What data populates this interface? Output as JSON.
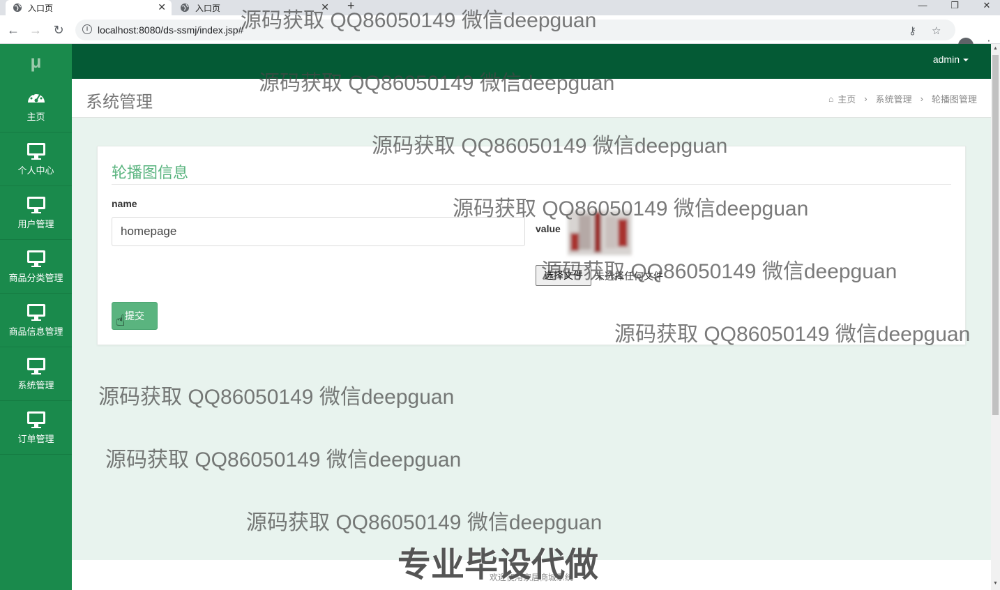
{
  "browser": {
    "tabs": [
      {
        "title": "入口页"
      },
      {
        "title": "入口页"
      }
    ],
    "url": "localhost:8080/ds-ssmj/index.jsp#",
    "url_info_glyph": "i"
  },
  "app": {
    "logo": "μ",
    "user": "admin",
    "sidebar": {
      "items": [
        {
          "label": "主页",
          "icon": "dashboard-icon"
        },
        {
          "label": "个人中心",
          "icon": "monitor-icon"
        },
        {
          "label": "用户管理",
          "icon": "monitor-icon"
        },
        {
          "label": "商品分类管理",
          "icon": "monitor-icon"
        },
        {
          "label": "商品信息管理",
          "icon": "monitor-icon"
        },
        {
          "label": "系统管理",
          "icon": "monitor-icon"
        },
        {
          "label": "订单管理",
          "icon": "monitor-icon"
        }
      ]
    },
    "page_title": "系统管理",
    "breadcrumb": [
      "主页",
      "系统管理",
      "轮播图管理"
    ],
    "form": {
      "title": "轮播图信息",
      "name_label": "name",
      "name_value": "homepage",
      "value_label": "value",
      "file_button": "选择文件",
      "file_status": "未选择任何文件",
      "submit": "提交"
    },
    "footer": "欢迎使用家居商城系统"
  },
  "watermarks": {
    "text": "源码获取 QQ86050149 微信deepguan",
    "banner": "专业毕设代做"
  },
  "colors": {
    "sidebar": "#1a8a4c",
    "topbar": "#045a35",
    "accent": "#5ab47f",
    "content_bg": "#e8f3ee"
  }
}
